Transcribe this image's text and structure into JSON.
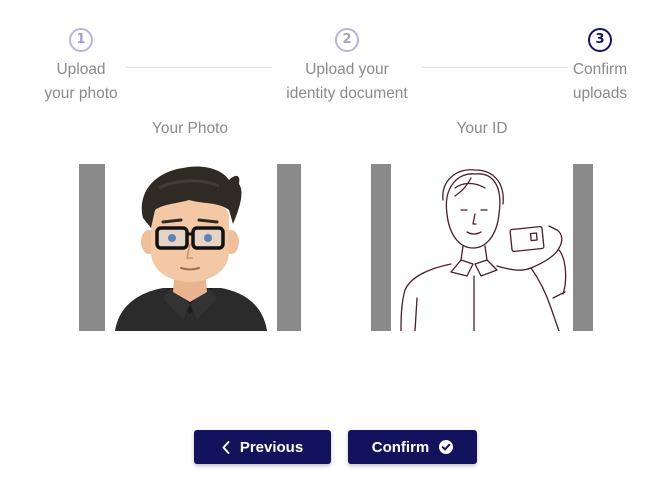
{
  "stepper": {
    "steps": [
      {
        "number": "1",
        "label_line1": "Upload",
        "label_line2": "your photo",
        "state": "inactive"
      },
      {
        "number": "2",
        "label_line1": "Upload your",
        "label_line2": "identity document",
        "state": "inactive"
      },
      {
        "number": "3",
        "label_line1": "Confirm",
        "label_line2": "uploads",
        "state": "active"
      }
    ]
  },
  "uploads": {
    "photo_title": "Your Photo",
    "id_title": "Your ID"
  },
  "actions": {
    "previous_label": "Previous",
    "confirm_label": "Confirm"
  },
  "colors": {
    "primary": "#12135c",
    "inactive_step": "#b9b6d6",
    "text_muted": "#8a8a8a"
  }
}
